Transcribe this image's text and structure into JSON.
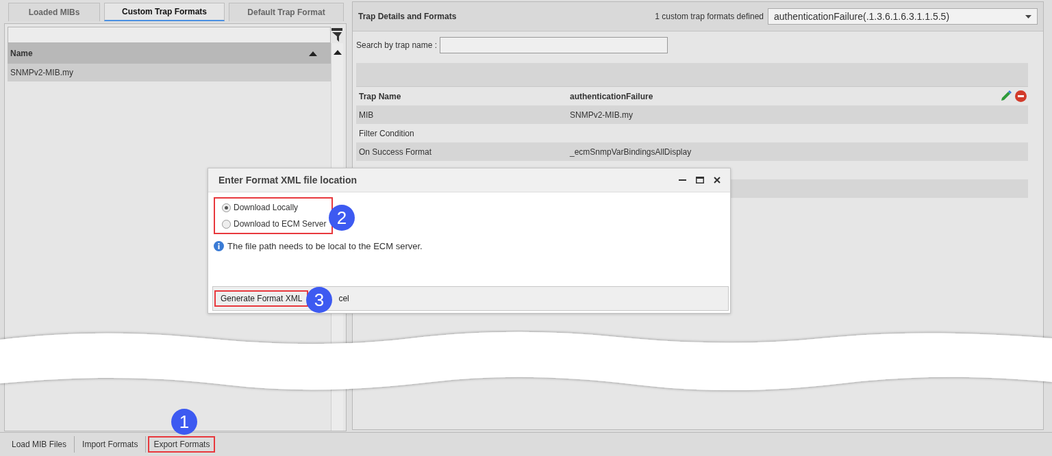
{
  "left_panel": {
    "tabs": [
      {
        "label": "Loaded MIBs",
        "selected": false
      },
      {
        "label": "Custom Trap Formats",
        "selected": true
      },
      {
        "label": "Default Trap Format",
        "selected": false
      }
    ],
    "table": {
      "columns": [
        "Name"
      ],
      "rows": [
        {
          "name": "SNMPv2-MIB.my",
          "selected": true
        }
      ]
    }
  },
  "right_panel": {
    "title": "Trap Details and Formats",
    "count_text": "1 custom trap formats defined",
    "trap_select": {
      "value": "authenticationFailure(.1.3.6.1.6.3.1.1.5.5)"
    },
    "search": {
      "label": "Search by trap name :"
    },
    "details": [
      {
        "kind": "header",
        "label": "Trap Name",
        "value": "authenticationFailure"
      },
      {
        "kind": "row",
        "label": "MIB",
        "value": "SNMPv2-MIB.my"
      },
      {
        "kind": "row",
        "label": "Filter Condition"
      },
      {
        "kind": "row",
        "label": "On Success Format",
        "value": "_ecmSnmpVarBindingsAllDisplay"
      }
    ]
  },
  "dialog": {
    "title": "Enter Format XML file location",
    "options": [
      {
        "label": "Download Locally",
        "selected": true
      },
      {
        "label": "Download to ECM Server",
        "selected": false
      }
    ],
    "info": "The file path needs to be local to the ECM server.",
    "buttons": [
      {
        "label": "Generate Format XML",
        "highlighted": true
      },
      {
        "label": "cel",
        "highlighted": false
      }
    ]
  },
  "toolbar": {
    "buttons": [
      {
        "label": "Load MIB Files",
        "highlighted": false
      },
      {
        "label": "Import Formats",
        "highlighted": false
      },
      {
        "label": "Export Formats",
        "highlighted": true
      }
    ]
  },
  "callouts": [
    {
      "number": "1"
    },
    {
      "number": "2"
    },
    {
      "number": "3"
    }
  ]
}
